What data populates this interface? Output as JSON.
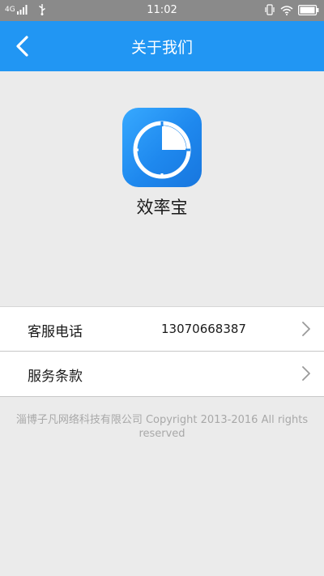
{
  "status_bar": {
    "network": "4G",
    "time": "11:02",
    "icons": [
      "signal-icon",
      "usb-icon",
      "vibrate-icon",
      "wifi-icon",
      "battery-icon"
    ]
  },
  "nav": {
    "title": "关于我们",
    "back_icon": "chevron-left-icon"
  },
  "app": {
    "name": "效率宝",
    "icon": "clock-icon"
  },
  "list": {
    "items": [
      {
        "label": "客服电话",
        "value": "13070668387"
      },
      {
        "label": "服务条款",
        "value": ""
      }
    ]
  },
  "footer": {
    "copyright": "淄博子凡网络科技有限公司 Copyright 2013-2016 All rights reserved"
  },
  "colors": {
    "nav_bg": "#2196f3",
    "status_bg": "#8a8a8a",
    "page_bg": "#ebebeb",
    "footer_text": "#a8a8a8"
  }
}
